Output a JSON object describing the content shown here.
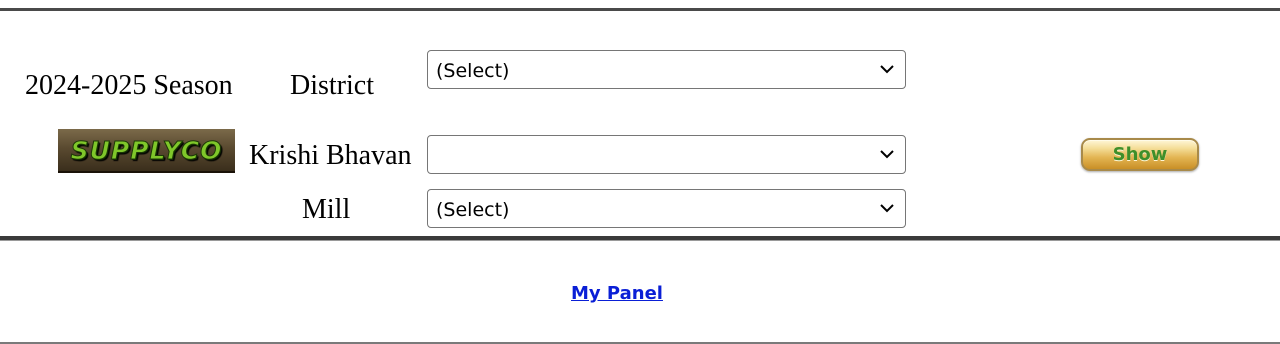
{
  "form": {
    "season_label": "2024-2025 Season",
    "district_label": "District",
    "krishi_bhavan_label": "Krishi Bhavan",
    "mill_label": "Mill",
    "district_select": {
      "selected": "(Select)"
    },
    "krishi_bhavan_select": {
      "selected": ""
    },
    "mill_select": {
      "selected": "(Select)"
    },
    "show_button": "Show"
  },
  "logo": {
    "text": "SUPPLYCO"
  },
  "footer": {
    "my_panel_link": "My Panel"
  },
  "colors": {
    "link": "#0a1fd6",
    "logo_text": "#7fc72a",
    "button_gold": "#e3b553",
    "button_text": "#3f8f2a"
  },
  "icons": {
    "dropdown": "chevron-down-icon"
  }
}
